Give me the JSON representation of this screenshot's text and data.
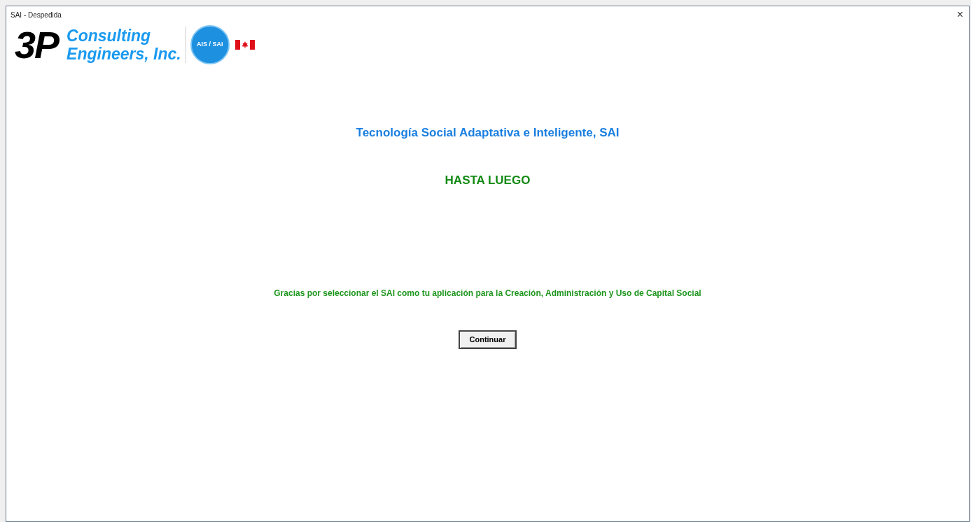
{
  "window": {
    "title": "SAI - Despedida",
    "close": "×"
  },
  "logo": {
    "mark": "3P",
    "company_line_1": "Consulting",
    "company_line_2": "Engineers, Inc.",
    "globe_text": "AIS / SAI"
  },
  "heading": "Tecnología Social Adaptativa e Inteligente, SAI",
  "farewell": "HASTA LUEGO",
  "message": "Gracias por seleccionar el SAI como tu aplicación para la Creación, Administración y Uso de Capital Social",
  "buttons": [
    "Continuar"
  ]
}
